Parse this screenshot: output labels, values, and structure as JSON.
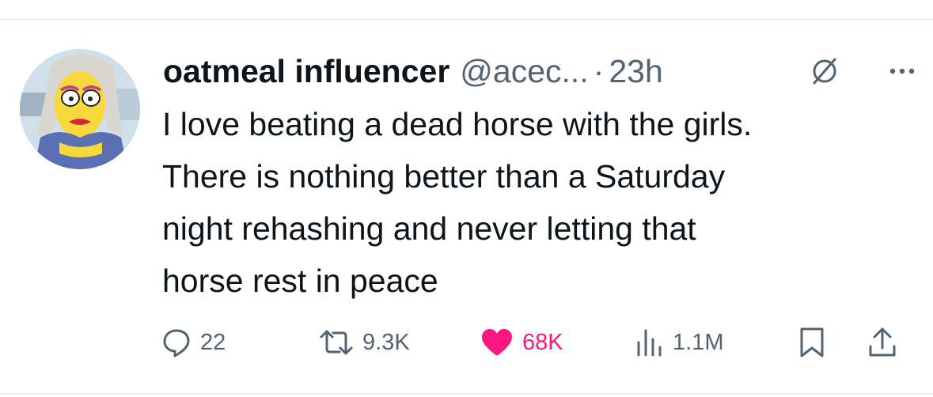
{
  "tweet": {
    "display_name": "oatmeal influencer",
    "handle": "@acec...",
    "separator": "·",
    "timestamp": "23h",
    "text_lines": [
      "I love beating a dead horse with the girls.",
      "There is nothing better than a Saturday",
      "night rehashing and never letting that",
      "horse rest in peace"
    ]
  },
  "actions": {
    "replies": "22",
    "reposts": "9.3K",
    "likes": "68K",
    "views": "1.1M"
  },
  "icons": {
    "header": [
      "grok-icon",
      "more-icon"
    ],
    "actions": [
      "reply-icon",
      "repost-icon",
      "heart-icon",
      "views-icon",
      "bookmark-icon",
      "share-icon"
    ]
  },
  "colors": {
    "text": "#0f1419",
    "secondary": "#536471",
    "like": "#f91880",
    "divider": "#e6e9eb"
  }
}
